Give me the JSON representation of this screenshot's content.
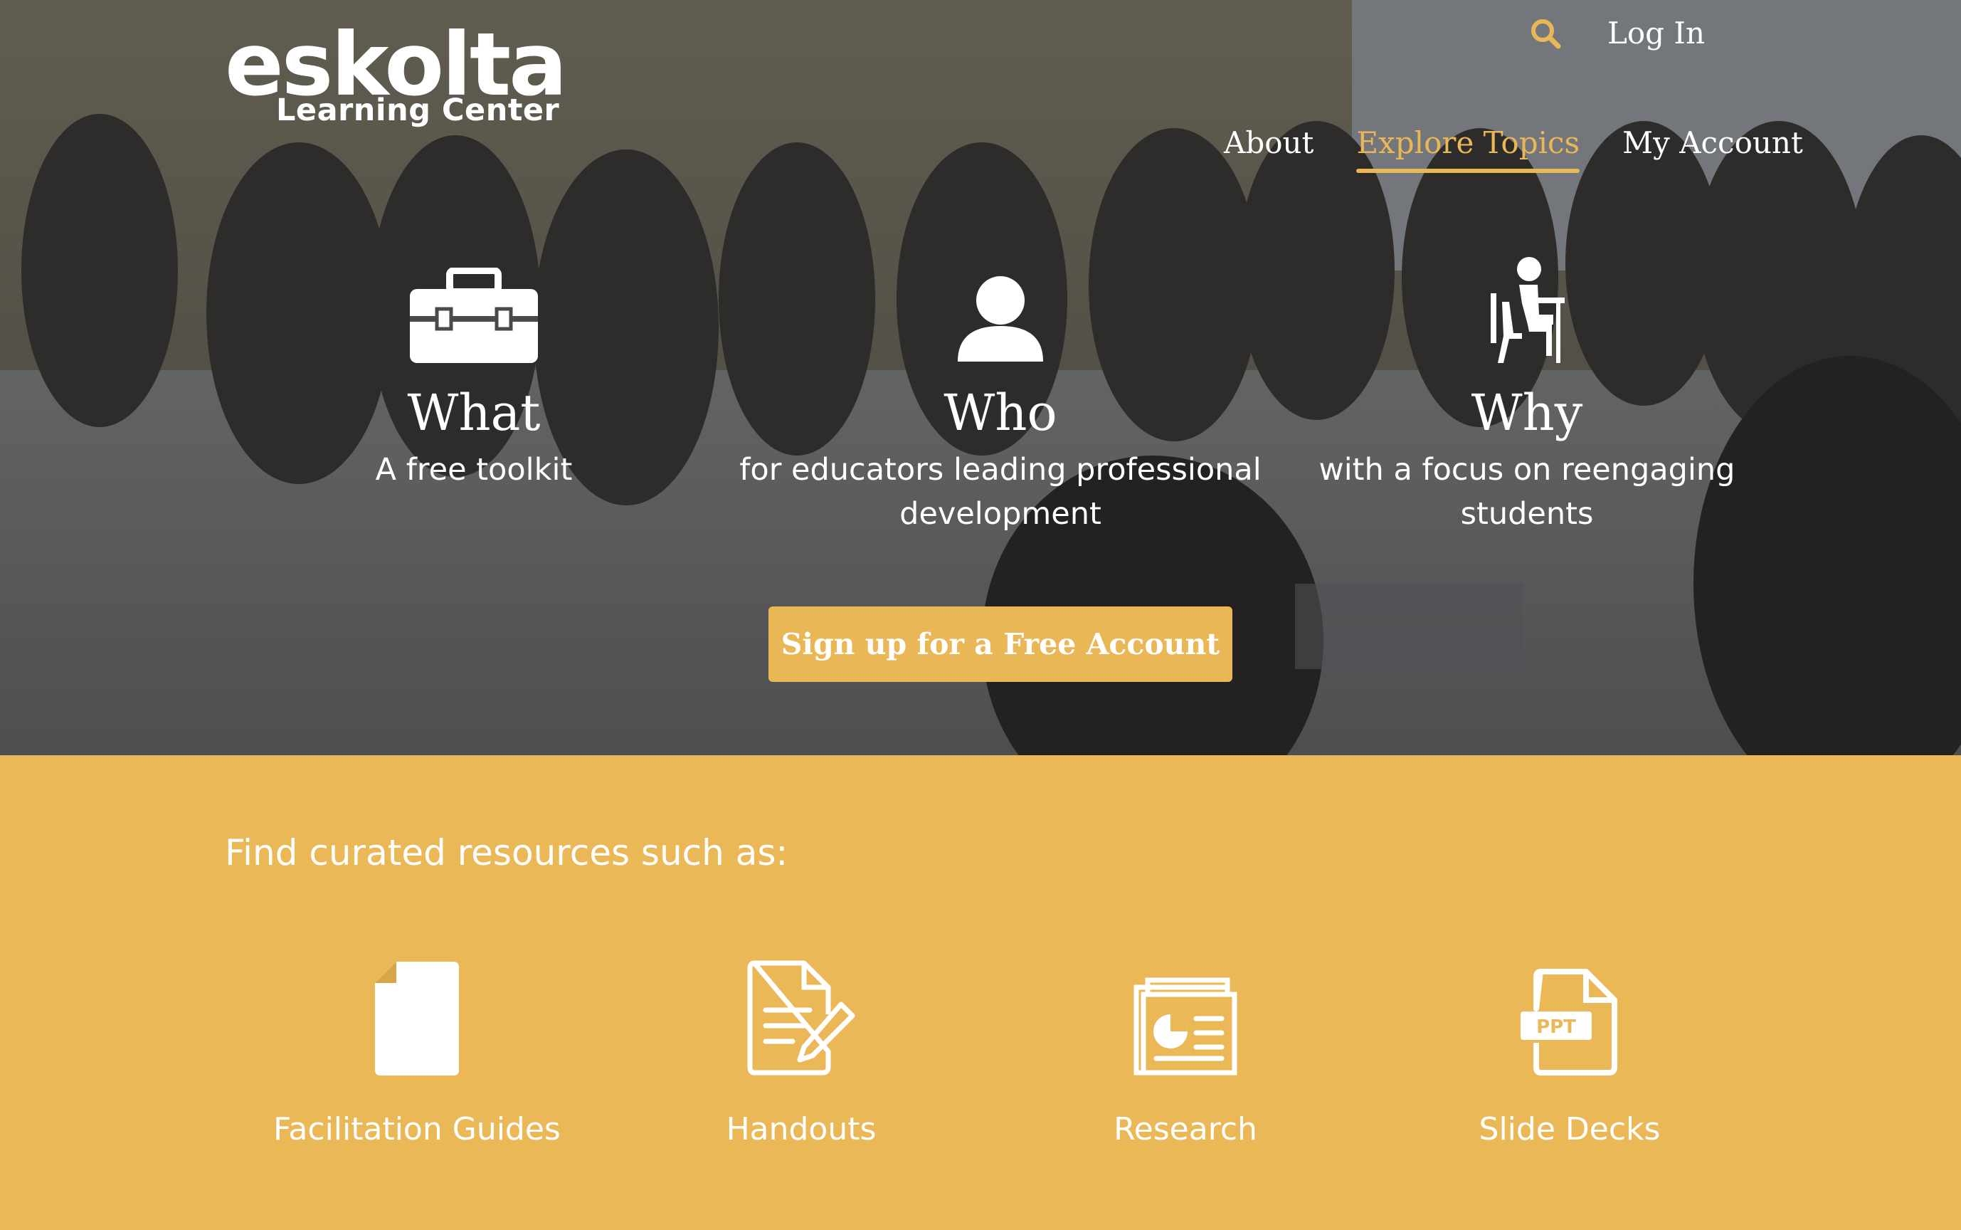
{
  "header": {
    "logo_word": "eskolta",
    "logo_sub": "Learning Center",
    "login_label": "Log In",
    "search_icon": "search-icon"
  },
  "nav": {
    "items": [
      {
        "label": "About",
        "active": false
      },
      {
        "label": "Explore Topics",
        "active": true
      },
      {
        "label": "My Account",
        "active": false
      }
    ]
  },
  "hero": {
    "features": [
      {
        "icon": "toolbox-icon",
        "title": "What",
        "desc": "A free toolkit"
      },
      {
        "icon": "person-icon",
        "title": "Who",
        "desc": "for educators leading professional development"
      },
      {
        "icon": "student-desk-icon",
        "title": "Why",
        "desc": "with a focus on reengaging students"
      }
    ],
    "cta_label": "Sign up for a Free Account"
  },
  "resources": {
    "heading": "Find curated resources such as:",
    "items": [
      {
        "icon": "document-icon",
        "label": "Facilitation Guides"
      },
      {
        "icon": "handout-pencil-icon",
        "label": "Handouts"
      },
      {
        "icon": "research-chart-icon",
        "label": "Research"
      },
      {
        "icon": "ppt-file-icon",
        "label": "Slide Decks"
      }
    ],
    "ppt_badge": "PPT"
  },
  "colors": {
    "accent": "#eab757",
    "section_bg": "#ebb858",
    "white": "#ffffff"
  }
}
